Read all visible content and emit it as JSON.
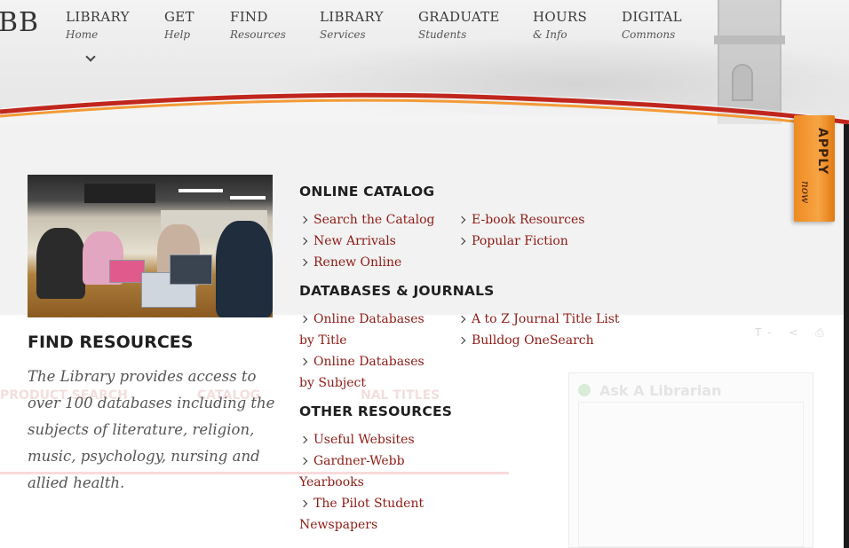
{
  "logo_fragment": "BB",
  "nav": [
    {
      "title": "LIBRARY",
      "sub": "Home"
    },
    {
      "title": "GET",
      "sub": "Help"
    },
    {
      "title": "FIND",
      "sub": "Resources"
    },
    {
      "title": "LIBRARY",
      "sub": "Services"
    },
    {
      "title": "GRADUATE",
      "sub": "Students"
    },
    {
      "title": "HOURS",
      "sub": "& Info"
    },
    {
      "title": "DIGITAL",
      "sub": "Commons"
    }
  ],
  "apply": {
    "label": "APPLY",
    "sub": "now"
  },
  "feature": {
    "title": "FIND RESOURCES",
    "description": "The Library provides access to over 100 databases including the subjects of literature, religion, music, psychology, nursing and allied health."
  },
  "sections": {
    "catalog": {
      "heading": "ONLINE CATALOG",
      "links": [
        "Search the Catalog",
        "New Arrivals",
        "Renew Online",
        "E-book Resources",
        "Popular Fiction"
      ]
    },
    "databases": {
      "heading": "DATABASES & JOURNALS",
      "links": [
        "Online Databases",
        "by Title",
        "Online Databases",
        "by Subject",
        "A to Z Journal Title List",
        "Bulldog OneSearch"
      ]
    },
    "other": {
      "heading": "OTHER RESOURCES",
      "links": [
        "Useful Websites",
        "Gardner-Webb",
        "Yearbooks",
        "The Pilot Student",
        "Newspapers"
      ]
    }
  },
  "background": {
    "ghost_search": "PRODUCT SEARCH",
    "ghost_catalog": "CATALOG",
    "ghost_titles": "NAL TITLES",
    "ghost_ask": "Ask A Librarian",
    "ghost_tools": "T- < ⎙"
  },
  "colors": {
    "link": "#8e1a14",
    "accent_orange": "#f39a36",
    "swoosh_red": "#c0261d"
  }
}
